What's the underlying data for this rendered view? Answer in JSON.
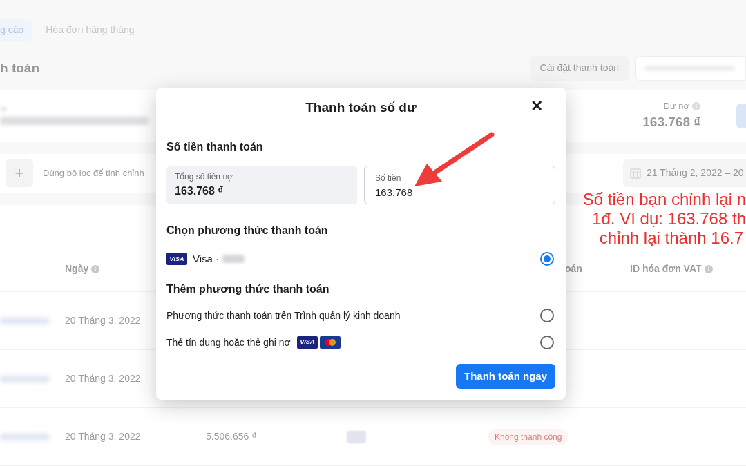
{
  "page": {
    "tabs": [
      {
        "label": "g cáo",
        "selected": true
      },
      {
        "label": "Hóa đơn hàng tháng",
        "selected": false
      }
    ],
    "heading": "h toán",
    "settings_button": "Cài đặt thanh toán",
    "balance": {
      "label": "Dư nợ",
      "value": "163.768 ₫"
    },
    "filter": {
      "add_button": "+",
      "placeholder": "Dùng bộ lọc để tinh chỉnh",
      "date_range": "21 Tháng 2, 2022 – 20"
    },
    "table": {
      "columns": [
        {
          "label": "Ngày",
          "info": true
        },
        {
          "label": "oán",
          "info": false
        },
        {
          "label": "ID hóa đơn VAT",
          "info": true
        }
      ],
      "rows": [
        {
          "date": "20 Tháng 3, 2022"
        },
        {
          "date": "20 Tháng 3, 2022"
        },
        {
          "date": "20 Tháng 3, 2022",
          "amount": "5.506.656 ₫",
          "status": "Không thành công"
        }
      ]
    }
  },
  "dialog": {
    "title": "Thanh toán số dư",
    "close": "✕",
    "amount_heading": "Số tiền thanh toán",
    "total": {
      "label": "Tổng số tiền nợ",
      "value": "163.768 ₫"
    },
    "amount_field": {
      "label": "Số tiền",
      "value": "163.768"
    },
    "choose_heading": "Chọn phương thức thanh toán",
    "saved_methods": [
      {
        "label": "Visa ·",
        "logo": {
          "kind": "visa",
          "text": "VISA"
        },
        "selected": true
      }
    ],
    "add_heading": "Thêm phương thức thanh toán",
    "add_methods": [
      {
        "label": "Phương thức thanh toán trên Trình quản lý kinh doanh",
        "selected": false
      },
      {
        "label": "Thẻ tín dụng hoặc thẻ ghi nợ",
        "selected": false,
        "logos": [
          {
            "kind": "visa",
            "text": "VISA"
          },
          {
            "kind": "mastercard"
          }
        ]
      }
    ],
    "pay_button": "Thanh toán ngay"
  },
  "annotation": {
    "lines": [
      "Số tiền bạn chỉnh lại n",
      "1đ. Ví dụ: 163.768 th",
      "chỉnh lại thành 16.7"
    ]
  }
}
